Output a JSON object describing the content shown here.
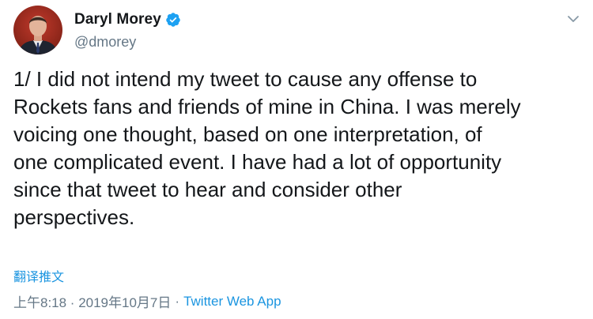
{
  "tweet": {
    "author": {
      "display_name": "Daryl Morey",
      "handle": "@dmorey",
      "verified": true
    },
    "text": "1/ I did not intend my tweet to cause any offense to\nRockets fans and friends of mine in China. I was merely\nvoicing one thought, based on one interpretation, of\none complicated event. I have had a lot of opportunity\nsince that tweet to hear and consider other\nperspectives.",
    "translate_label": "翻译推文",
    "timestamp": "上午8:18 · 2019年10月7日",
    "separator": "·",
    "source": "Twitter Web App"
  },
  "icons": {
    "verified": "verified-badge-icon",
    "menu": "chevron-down-icon",
    "avatar": "profile-photo"
  },
  "colors": {
    "text": "#14171a",
    "secondary": "#657786",
    "link": "#1b95e0",
    "verified": "#1da1f2"
  }
}
